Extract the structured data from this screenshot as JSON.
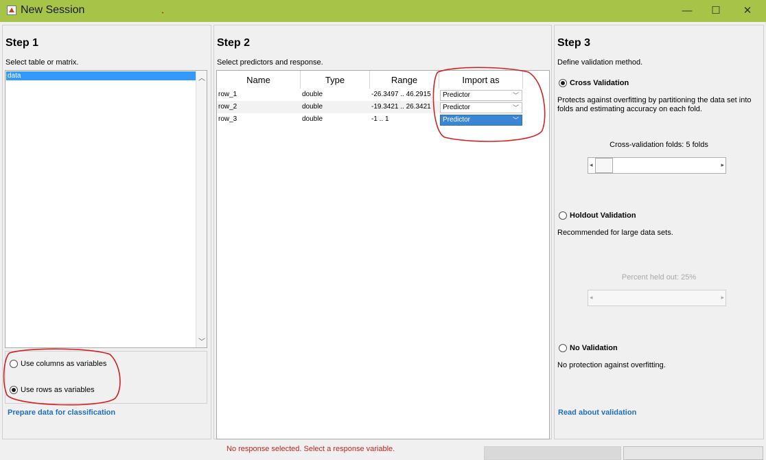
{
  "window": {
    "title": "New Session",
    "minimize": "—",
    "maximize": "☐",
    "close": "✕"
  },
  "step1": {
    "title": "Step 1",
    "subtitle": "Select table or matrix.",
    "list_items": [
      "data"
    ],
    "options": [
      {
        "label": "Use columns as variables",
        "checked": false
      },
      {
        "label": "Use rows as variables",
        "checked": true
      }
    ],
    "link": "Prepare data for classification"
  },
  "step2": {
    "title": "Step 2",
    "subtitle": "Select predictors and response.",
    "columns": [
      "Name",
      "Type",
      "Range",
      "Import as"
    ],
    "rows": [
      {
        "name": "row_1",
        "type": "double",
        "range": "-26.3497 .. 46.2915",
        "import_as": "Predictor"
      },
      {
        "name": "row_2",
        "type": "double",
        "range": "-19.3421 .. 26.3421",
        "import_as": "Predictor"
      },
      {
        "name": "row_3",
        "type": "double",
        "range": "-1 .. 1",
        "import_as": "Predictor"
      }
    ]
  },
  "step3": {
    "title": "Step 3",
    "subtitle": "Define validation method.",
    "cross": {
      "label": "Cross Validation",
      "desc": "Protects against overfitting by partitioning the data set into folds and estimating accuracy on each fold.",
      "slider_label": "Cross-validation folds: 5 folds"
    },
    "holdout": {
      "label": "Holdout Validation",
      "desc": "Recommended for large data sets.",
      "slider_label": "Percent held out: 25%"
    },
    "none": {
      "label": "No Validation",
      "desc": "No protection against overfitting."
    },
    "link": "Read about validation"
  },
  "status": "No response selected. Select a response variable.",
  "colors": {
    "titlebar": "#a6c448",
    "link": "#1f6ebf",
    "selection": "#3399ff",
    "status": "#c8231a",
    "annotation": "#d42020"
  }
}
